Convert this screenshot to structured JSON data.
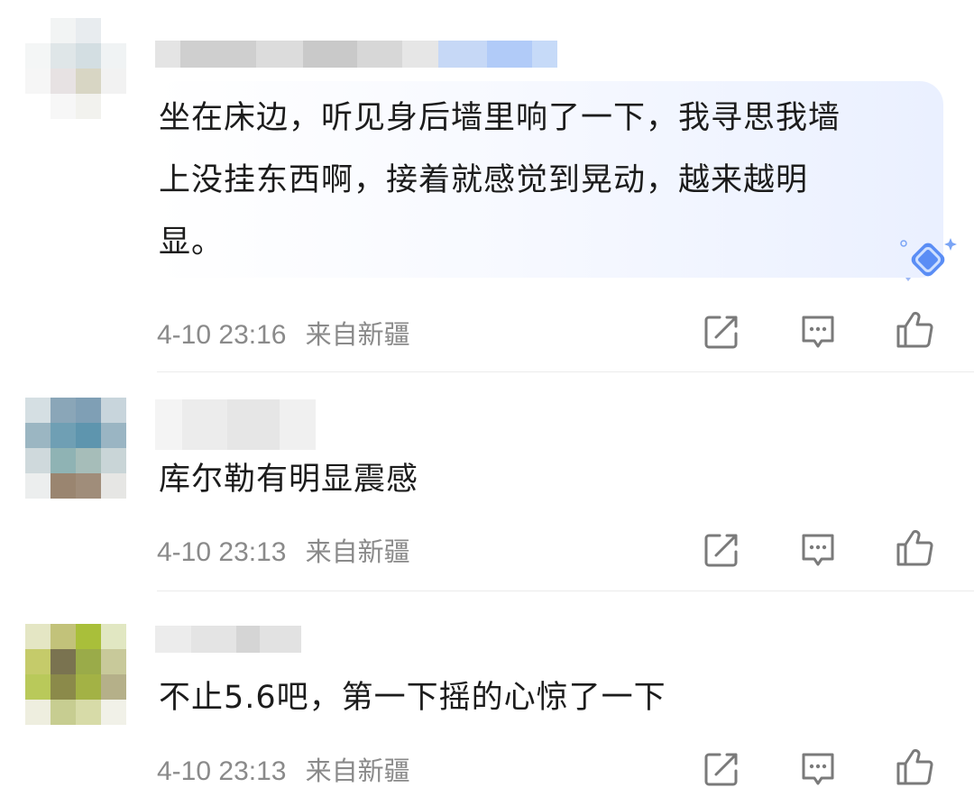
{
  "comments": [
    {
      "text": "坐在床边，听见身后墙里响了一下，我寻思我墙上没挂东西啊，接着就感觉到晃动，越来越明显。",
      "lines": [
        "坐在床边，听见身后墙里响了一下，我寻思我墙",
        "上没挂东西啊，接着就感觉到晃动，越来越明",
        "显。"
      ],
      "date": "4-10 23:16",
      "location": "来自新疆"
    },
    {
      "text": "库尔勒有明显震感",
      "lines": [
        "库尔勒有明显震感"
      ],
      "date": "4-10 23:13",
      "location": "来自新疆"
    },
    {
      "text": "不止5.6吧，第一下摇的心惊了一下",
      "lines": [
        "不止5.6吧，第一下摇的心惊了一下"
      ],
      "date": "4-10 23:13",
      "location": "来自新疆"
    }
  ],
  "colors": {
    "text": "#1c1c1c",
    "meta": "#8a8a8a",
    "icon": "#7a7a7a",
    "accent": "#4a7cf0"
  },
  "icons": {
    "share": "share-icon",
    "reply": "comment-icon",
    "like": "thumbs-up-icon"
  }
}
